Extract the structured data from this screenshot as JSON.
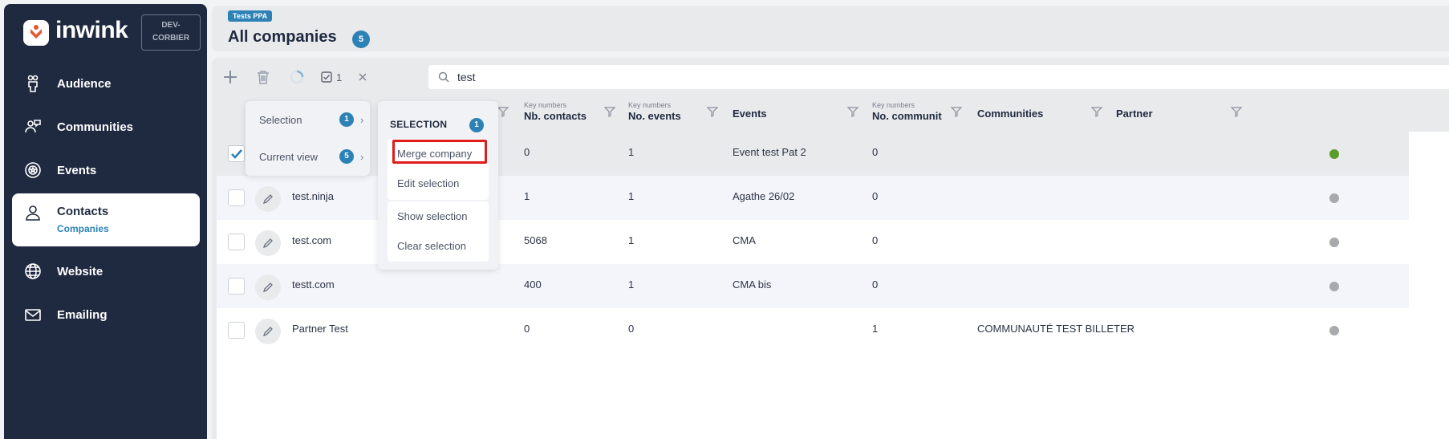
{
  "sidebar": {
    "logo_text": "inwink",
    "env_badge_line1": "DEV-",
    "env_badge_line2": "CORBIER",
    "items": [
      {
        "label": "Audience",
        "icon": "audience-icon"
      },
      {
        "label": "Communities",
        "icon": "communities-icon"
      },
      {
        "label": "Events",
        "icon": "events-icon"
      },
      {
        "label": "Contacts",
        "icon": "contact-icon",
        "sub": "Companies"
      },
      {
        "label": "Website",
        "icon": "globe-icon"
      },
      {
        "label": "Emailing",
        "icon": "mail-icon"
      }
    ]
  },
  "header": {
    "tag": "Tests PPA",
    "title": "All companies",
    "count": "5"
  },
  "toolbar": {
    "selected_count": "1",
    "search_value": "test"
  },
  "columns": [
    {
      "pre": "Key numbers",
      "label": "Nb. contacts"
    },
    {
      "pre": "Key numbers",
      "label": "No. events"
    },
    {
      "pre": "",
      "label": "Events"
    },
    {
      "pre": "Key numbers",
      "label": "No. communit"
    },
    {
      "pre": "",
      "label": "Communities"
    },
    {
      "pre": "",
      "label": "Partner"
    }
  ],
  "rows": [
    {
      "name": "",
      "contacts": "0",
      "events_count": "1",
      "events": "Event test Pat 2",
      "communities_count": "0",
      "communities": "",
      "partner": "green"
    },
    {
      "name": "test.ninja",
      "contacts": "1",
      "events_count": "1",
      "events": "Agathe 26/02",
      "communities_count": "0",
      "communities": "",
      "partner": "grey"
    },
    {
      "name": "test.com",
      "contacts": "5068",
      "events_count": "1",
      "events": "CMA",
      "communities_count": "0",
      "communities": "",
      "partner": "grey"
    },
    {
      "name": "testt.com",
      "contacts": "400",
      "events_count": "1",
      "events": "CMA bis",
      "communities_count": "0",
      "communities": "",
      "partner": "grey"
    },
    {
      "name": "Partner Test",
      "contacts": "0",
      "events_count": "0",
      "events": "",
      "communities_count": "1",
      "communities": "COMMUNAUTÉ TEST BILLETER",
      "partner": "grey"
    }
  ],
  "menu1": {
    "items": [
      {
        "label": "Selection",
        "count": "1"
      },
      {
        "label": "Current view",
        "count": "5"
      }
    ]
  },
  "menu2": {
    "title": "SELECTION",
    "count": "1",
    "merge": "Merge company",
    "edit": "Edit selection",
    "show": "Show selection",
    "clear": "Clear selection"
  },
  "colors": {
    "accent": "#2d82b5",
    "sidebar": "#1f2a40",
    "highlight": "#e01b1b"
  }
}
